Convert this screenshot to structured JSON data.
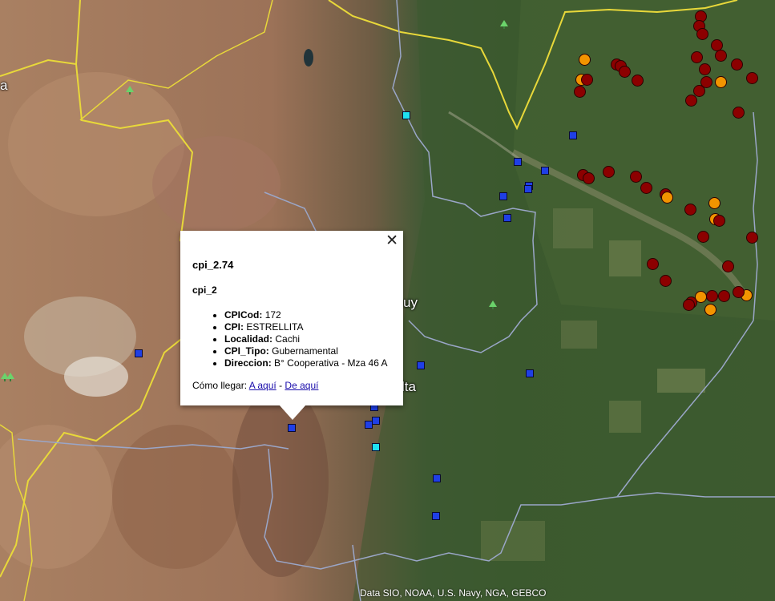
{
  "map": {
    "labels": [
      "a",
      "uy",
      "lta"
    ],
    "attribution": "Data SIO, NOAA, U.S. Navy, NGA, GEBCO"
  },
  "popup": {
    "close_glyph": "✕",
    "title": "cpi_2.74",
    "layer": "cpi_2",
    "fields": [
      {
        "name": "CPICod",
        "value": "172"
      },
      {
        "name": "CPI",
        "value": "ESTRELLITA"
      },
      {
        "name": "Localidad",
        "value": "Cachi"
      },
      {
        "name": "CPI_Tipo",
        "value": "Gubernamental"
      },
      {
        "name": "Direccion",
        "value": "B° Cooperativa - Mza 46 A"
      }
    ],
    "directions_label": "Cómo llegar:",
    "to_here": "A aquí",
    "separator": "-",
    "from_here": "De aquí"
  },
  "colors": {
    "blue_marker": "#1f3fe6",
    "cyan_marker": "#1fe0f0",
    "red_marker": "#8c0000",
    "orange_marker": "#f29400",
    "border_yellow": "#e8d83a",
    "border_gray": "#9aa6c8"
  },
  "icons": {
    "close": "close-icon",
    "tree": "tree-icon"
  }
}
